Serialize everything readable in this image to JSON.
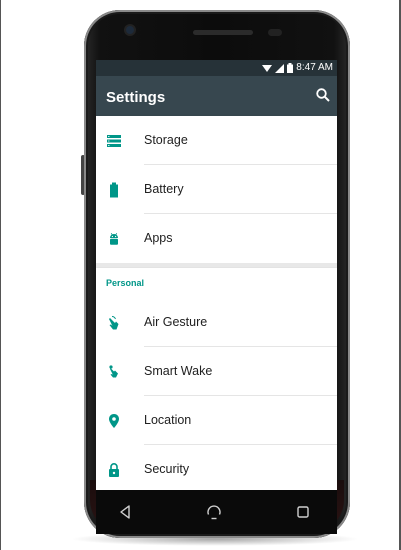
{
  "status_bar": {
    "time": "8:47 AM",
    "icons": [
      "wifi-icon",
      "signal-icon",
      "battery-icon"
    ]
  },
  "app_bar": {
    "title": "Settings",
    "search_icon": "search-icon"
  },
  "sections": [
    {
      "header": "",
      "items": [
        {
          "label": "Storage",
          "icon": "storage-icon"
        },
        {
          "label": "Battery",
          "icon": "battery-icon"
        },
        {
          "label": "Apps",
          "icon": "android-icon"
        }
      ]
    },
    {
      "header": "Personal",
      "items": [
        {
          "label": "Air Gesture",
          "icon": "air-gesture-icon"
        },
        {
          "label": "Smart Wake",
          "icon": "smart-wake-icon"
        },
        {
          "label": "Location",
          "icon": "location-pin-icon"
        },
        {
          "label": "Security",
          "icon": "lock-icon"
        }
      ]
    }
  ],
  "nav_bar": {
    "buttons": [
      "back-icon",
      "home-icon",
      "recents-icon"
    ]
  },
  "colors": {
    "accent": "#009688",
    "app_bar": "#37474f",
    "status_bar": "#263238",
    "text_primary": "#212121"
  }
}
